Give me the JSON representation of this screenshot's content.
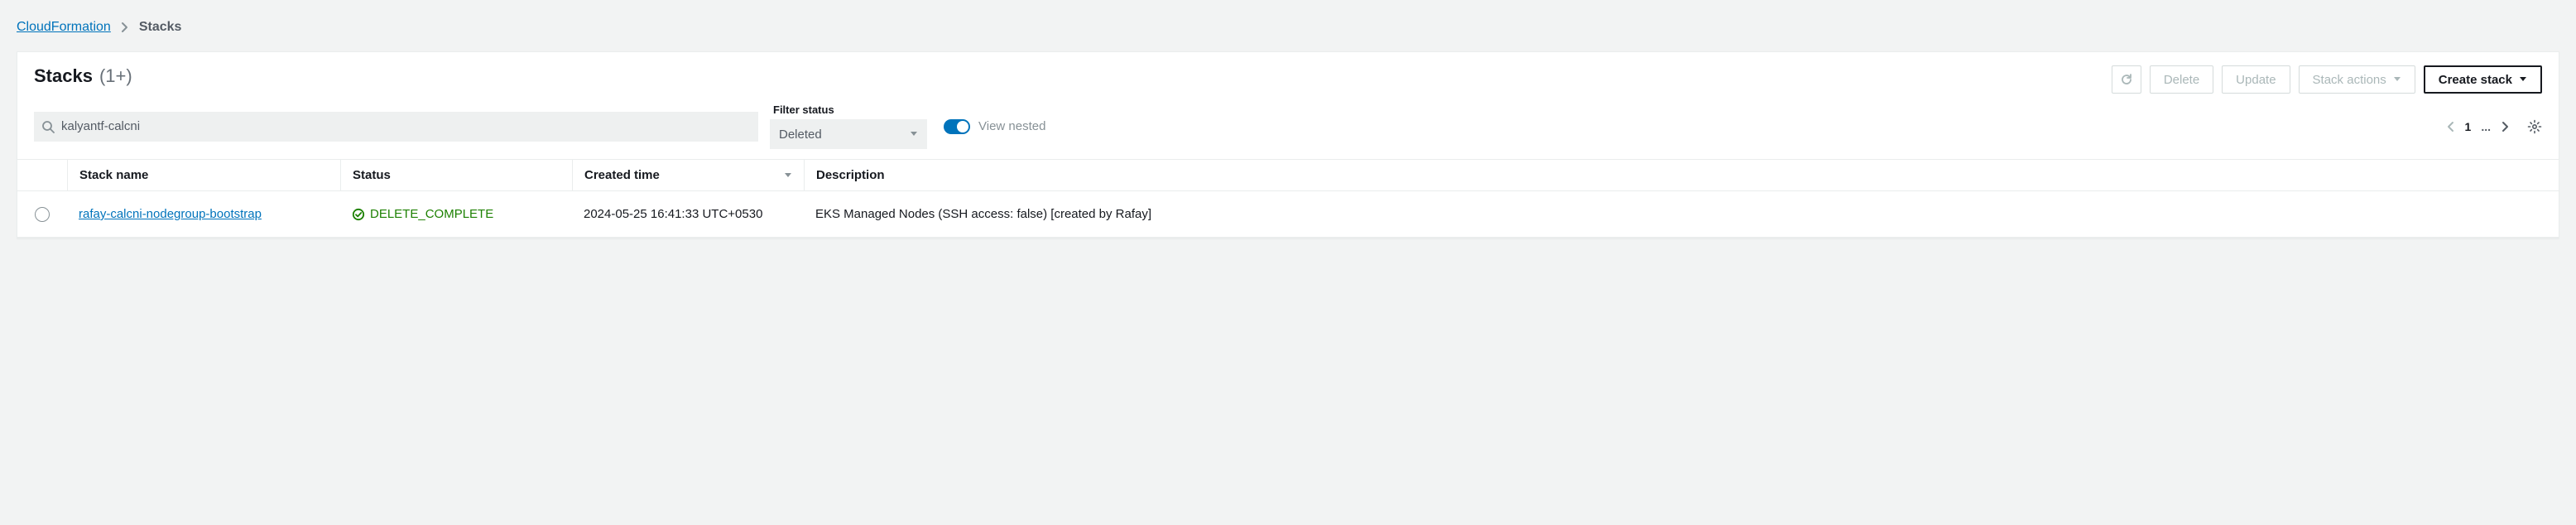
{
  "breadcrumb": {
    "root": "CloudFormation",
    "current": "Stacks"
  },
  "header": {
    "title": "Stacks",
    "count": "(1+)"
  },
  "actions": {
    "delete": "Delete",
    "update": "Update",
    "stack_actions": "Stack actions",
    "create_stack": "Create stack"
  },
  "filters": {
    "search_value": "kalyantf-calcni",
    "status_label": "Filter status",
    "status_value": "Deleted",
    "view_nested": "View nested"
  },
  "pager": {
    "page": "1",
    "ellipsis": "..."
  },
  "columns": {
    "stack_name": "Stack name",
    "status": "Status",
    "created_time": "Created time",
    "description": "Description"
  },
  "rows": [
    {
      "name": "rafay-calcni-nodegroup-bootstrap",
      "status": "DELETE_COMPLETE",
      "created_time": "2024-05-25 16:41:33 UTC+0530",
      "description": "EKS Managed Nodes (SSH access: false) [created by Rafay]"
    }
  ]
}
